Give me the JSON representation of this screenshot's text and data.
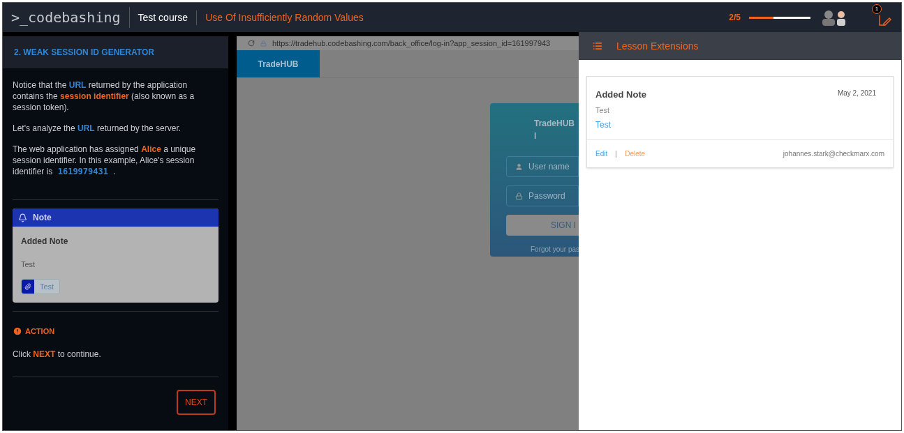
{
  "header": {
    "logo": ">_codebashing",
    "course": "Test course",
    "lesson": "Use Of Insufficiently Random Values",
    "progress_text": "2/5",
    "progress": {
      "level": 0.4
    },
    "badge": "1"
  },
  "sidebar": {
    "section_title": "2. WEAK SESSION ID GENERATOR",
    "paragraphs": [
      [
        {
          "kind": "plain",
          "text": "Notice that the "
        },
        {
          "kind": "blue",
          "text": "URL"
        },
        {
          "kind": "plain",
          "text": " returned by the application contains the "
        },
        {
          "kind": "orange",
          "text": "session identifier"
        },
        {
          "kind": "plain",
          "text": " (also known as a session token)."
        }
      ],
      [
        {
          "kind": "plain",
          "text": "Let's analyze the "
        },
        {
          "kind": "blue",
          "text": "URL"
        },
        {
          "kind": "plain",
          "text": " returned by the server."
        }
      ],
      [
        {
          "kind": "plain",
          "text": "The web application has assigned "
        },
        {
          "kind": "orange",
          "text": "Alice"
        },
        {
          "kind": "plain",
          "text": " a unique session identifier. In this example, Alice's session identifier is "
        },
        {
          "kind": "code",
          "text": "1619979431"
        },
        {
          "kind": "plain",
          "text": " ."
        }
      ]
    ],
    "note": {
      "header": "Note",
      "title": "Added Note",
      "body": "Test",
      "link": "Test"
    },
    "action": {
      "title": "ACTION",
      "text": [
        {
          "kind": "plain",
          "text": "Click "
        },
        {
          "kind": "orange",
          "text": "NEXT"
        },
        {
          "kind": "plain",
          "text": " to continue."
        }
      ]
    },
    "next_button": "NEXT"
  },
  "browser": {
    "url": "https://tradehub.codebashing.com/back_office/log-in?app_session_id=161997943",
    "brand": "TradeHUB",
    "login": {
      "title": "TradeHUB l",
      "username_placeholder": "User name",
      "password_placeholder": "Password",
      "button": "SIGN I",
      "forgot": "Forgot your pas"
    }
  },
  "extensions": {
    "title": "Lesson Extensions",
    "notes": [
      {
        "title": "Added Note",
        "date": "May 2, 2021",
        "body": "Test",
        "link": "Test",
        "edit": "Edit",
        "delete": "Delete",
        "author": "johannes.stark@checkmarx.com"
      }
    ]
  }
}
